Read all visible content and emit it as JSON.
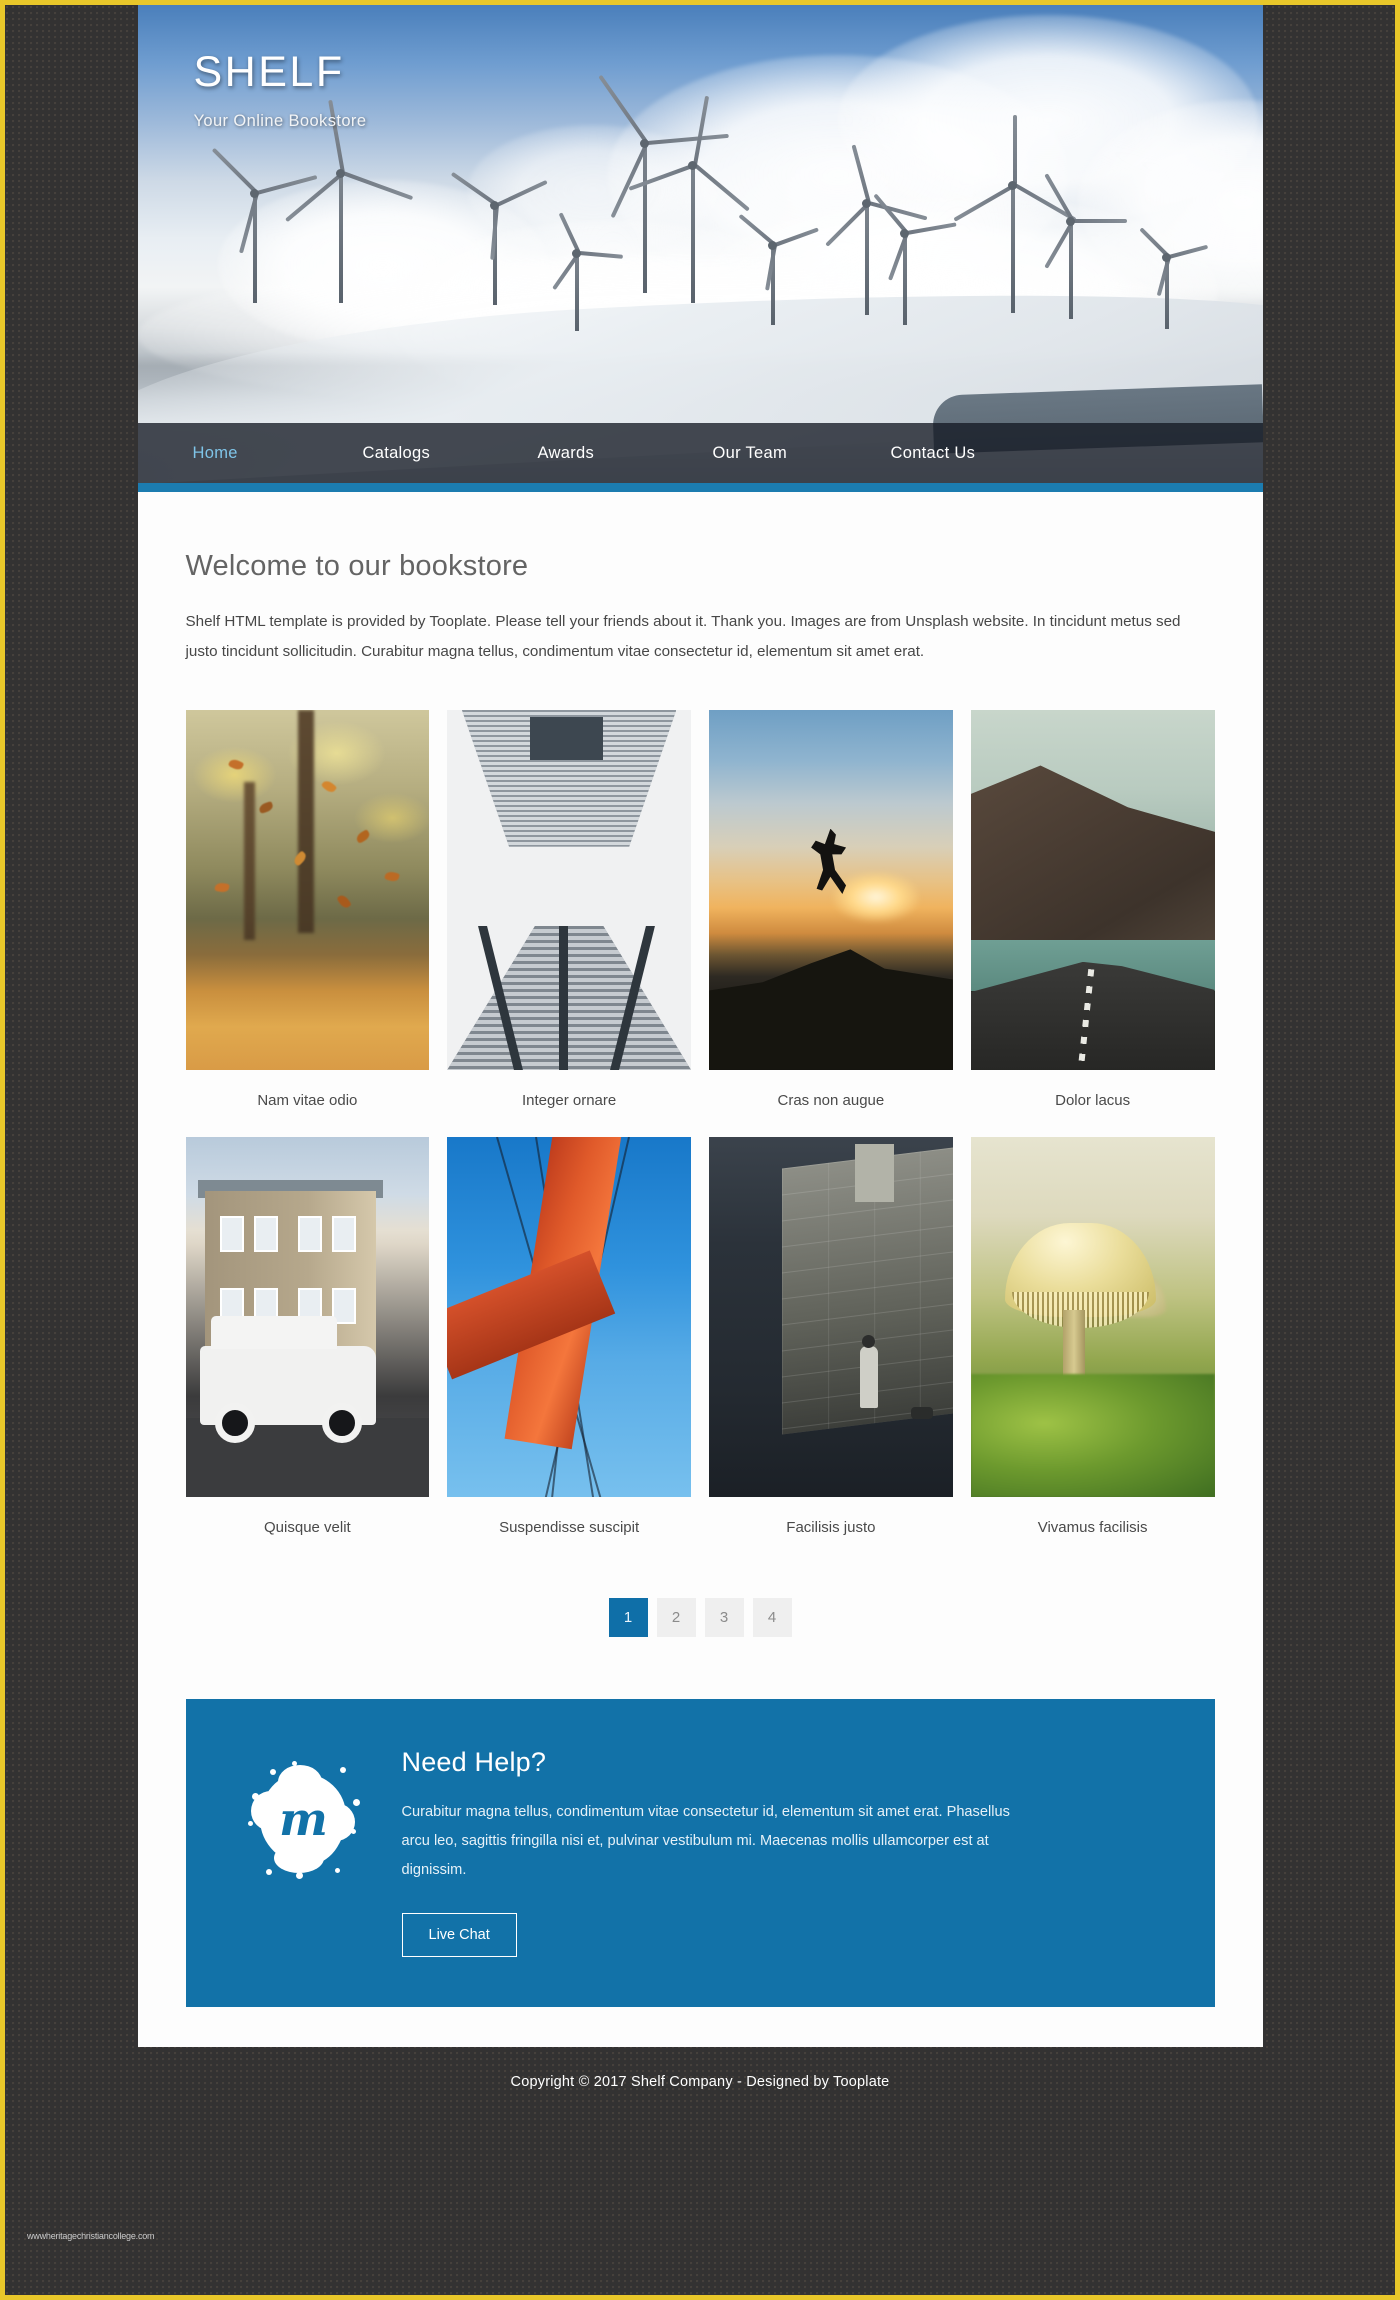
{
  "site": {
    "title": "SHELF",
    "tagline": "Your Online Bookstore"
  },
  "nav": {
    "items": [
      {
        "label": "Home",
        "active": true
      },
      {
        "label": "Catalogs",
        "active": false
      },
      {
        "label": "Awards",
        "active": false
      },
      {
        "label": "Our Team",
        "active": false
      },
      {
        "label": "Contact Us",
        "active": false
      }
    ],
    "accent_color": "#7fc4e8",
    "underline_color": "#1c7cb0"
  },
  "welcome": {
    "heading": "Welcome to our bookstore",
    "paragraph": "Shelf HTML template is provided by Tooplate. Please tell your friends about it. Thank you. Images are from Unsplash website. In tincidunt metus sed justo tincidunt sollicitudin. Curabitur magna tellus, condimentum vitae consectetur id, elementum sit amet erat."
  },
  "gallery": {
    "row1": [
      {
        "caption": "Nam vitae odio",
        "image": "autumn-forest-falling-leaves"
      },
      {
        "caption": "Integer ornare",
        "image": "skyscraper-looking-up"
      },
      {
        "caption": "Cras non augue",
        "image": "person-jumping-sunset-silhouette"
      },
      {
        "caption": "Dolor lacus",
        "image": "coastal-road-mountain"
      }
    ],
    "row2": [
      {
        "caption": "Quisque velit",
        "image": "white-jeep-parked-house"
      },
      {
        "caption": "Suspendisse suscipit",
        "image": "golden-gate-bridge-tower"
      },
      {
        "caption": "Facilisis justo",
        "image": "person-stone-wall-dog"
      },
      {
        "caption": "Vivamus facilisis",
        "image": "mushroom-macro-moss"
      }
    ]
  },
  "pagination": {
    "pages": [
      "1",
      "2",
      "3",
      "4"
    ],
    "active_index": 0,
    "active_color": "#0f6fa8",
    "inactive_color": "#efefef"
  },
  "help": {
    "logo_letter": "m",
    "title": "Need Help?",
    "text": "Curabitur magna tellus, condimentum vitae consectetur id, elementum sit amet erat. Phasellus arcu leo, sagittis fringilla nisi et, pulvinar vestibulum mi. Maecenas mollis ullamcorper est at dignissim.",
    "button_label": "Live Chat",
    "background_color": "#1272a8"
  },
  "footer": {
    "copyright": "Copyright © 2017 Shelf Company - Designed by Tooplate",
    "watermark": "wwwheritagechristiancollege.com"
  },
  "theme": {
    "page_border_color": "#e8c72a",
    "page_background_color": "#333232",
    "content_background_color": "#fdfdfd"
  }
}
